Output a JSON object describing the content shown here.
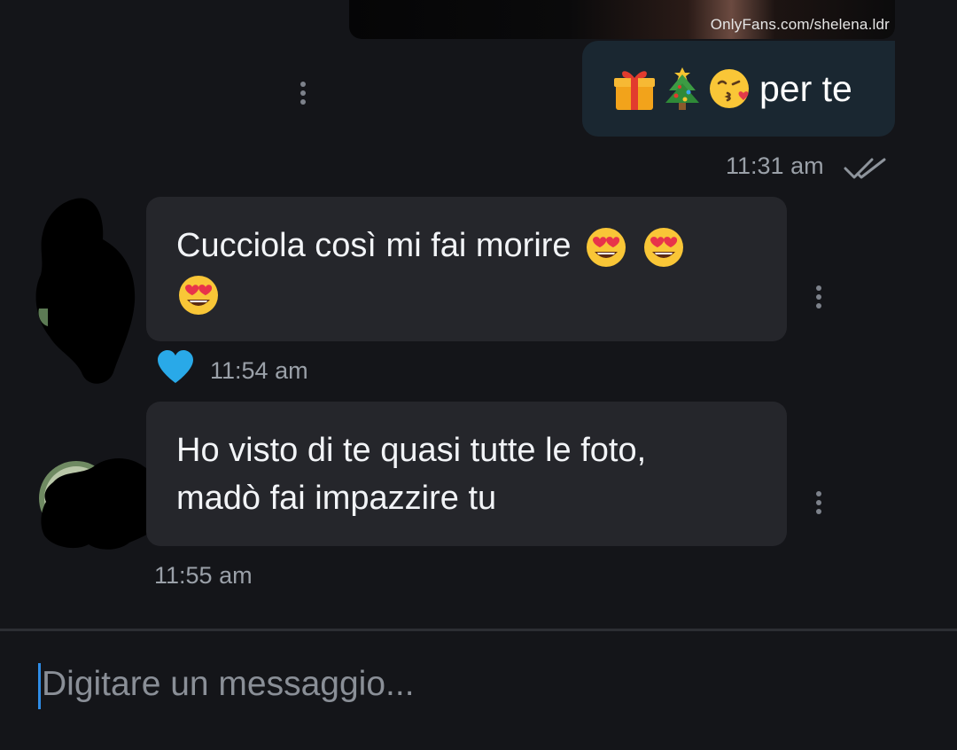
{
  "media": {
    "watermark": "OnlyFans.com/shelena.ldr"
  },
  "outgoing": {
    "emojis": [
      "gift-emoji",
      "christmas-tree-emoji",
      "kissing-face-emoji"
    ],
    "text": "per te",
    "time": "11:31 am",
    "status_icon": "double-check-icon"
  },
  "messages": [
    {
      "text_line1": "Cucciola così mi fai morire",
      "emojis": [
        "heart-eyes-emoji",
        "heart-eyes-emoji",
        "heart-eyes-emoji"
      ],
      "reaction": "blue-heart-icon",
      "time": "11:54 am"
    },
    {
      "text_line1": "Ho visto di te quasi tutte le foto,",
      "text_line2": "madò fai impazzire tu",
      "time": "11:55 am"
    }
  ],
  "composer": {
    "placeholder": "Digitare un messaggio..."
  },
  "colors": {
    "background": "#141519",
    "outgoing_bubble": "#1a2731",
    "incoming_bubble": "#25262b",
    "accent": "#29a9e8"
  }
}
